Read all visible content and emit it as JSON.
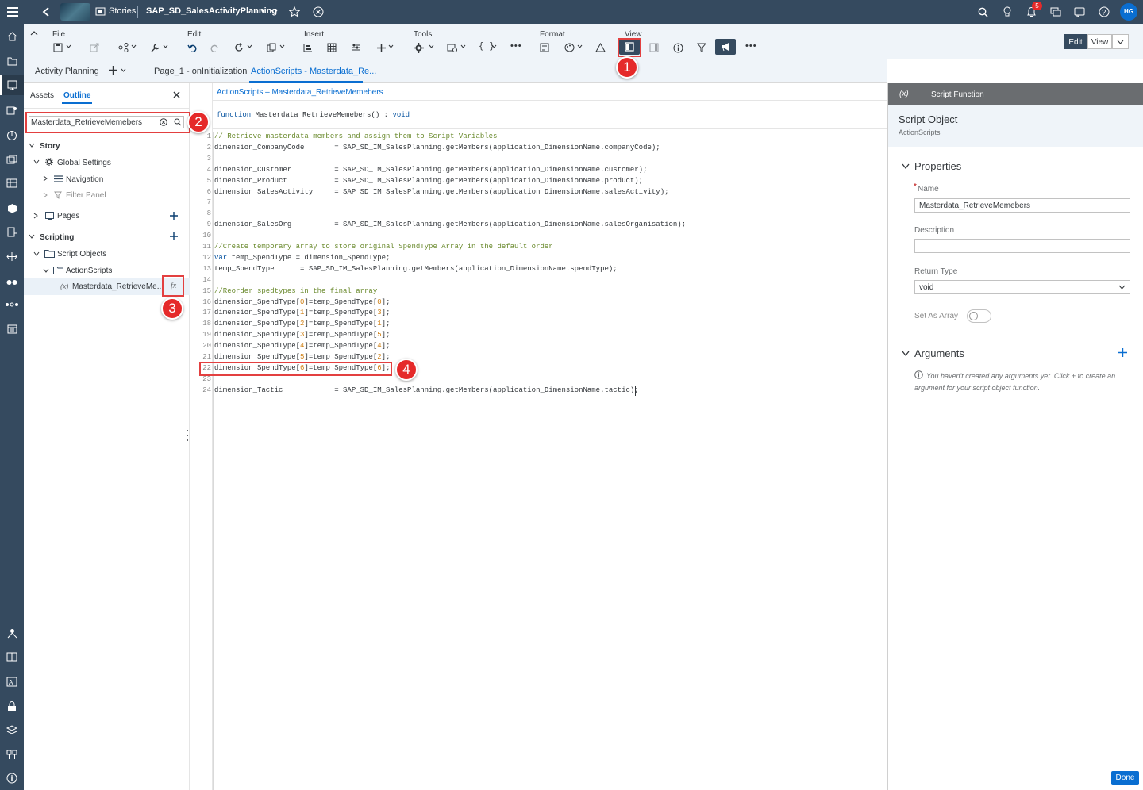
{
  "shell": {
    "app_label": "Stories",
    "story_title": "SAP_SD_SalesActivityPlanning",
    "notification_count": "5",
    "user_initials": "HG"
  },
  "toolbar": {
    "file": "File",
    "edit": "Edit",
    "insert": "Insert",
    "tools": "Tools",
    "format": "Format",
    "view": "View",
    "edit_btn": "Edit",
    "view_btn": "View"
  },
  "tabs": {
    "page_tab": "Activity Planning",
    "page1": "Page_1 - onInitialization",
    "actionscripts": "ActionScripts - Masterdata_Re..."
  },
  "left_panel": {
    "tab_assets": "Assets",
    "tab_outline": "Outline",
    "search_value": "Masterdata_RetrieveMemebers",
    "story": "Story",
    "global_settings": "Global Settings",
    "navigation": "Navigation",
    "filter_panel": "Filter Panel",
    "pages": "Pages",
    "scripting": "Scripting",
    "script_objects": "Script Objects",
    "actionscripts": "ActionScripts",
    "function_prefix": "(x)",
    "function_name": "Masterdata_RetrieveMe...",
    "fx_label": "fx"
  },
  "editor": {
    "breadcrumb": "ActionScripts – Masterdata_RetrieveMemebers",
    "signature_kw": "function",
    "signature_name": "Masterdata_RetrieveMemebers() :",
    "signature_type": "void",
    "lines": [
      {
        "n": "1",
        "t": "// Retrieve masterdata members and assign them to Script Variables"
      },
      {
        "n": "2",
        "t": "dimension_CompanyCode       = SAP_SD_IM_SalesPlanning.getMembers(application_DimensionName.companyCode);"
      },
      {
        "n": "3",
        "t": ""
      },
      {
        "n": "4",
        "t": "dimension_Customer          = SAP_SD_IM_SalesPlanning.getMembers(application_DimensionName.customer);"
      },
      {
        "n": "5",
        "t": "dimension_Product           = SAP_SD_IM_SalesPlanning.getMembers(application_DimensionName.product);"
      },
      {
        "n": "6",
        "t": "dimension_SalesActivity     = SAP_SD_IM_SalesPlanning.getMembers(application_DimensionName.salesActivity);"
      },
      {
        "n": "7",
        "t": ""
      },
      {
        "n": "8",
        "t": ""
      },
      {
        "n": "9",
        "t": "dimension_SalesOrg          = SAP_SD_IM_SalesPlanning.getMembers(application_DimensionName.salesOrganisation);"
      },
      {
        "n": "10",
        "t": ""
      },
      {
        "n": "11",
        "t": "//Create temporary array to store original SpendType Array in the default order"
      },
      {
        "n": "12",
        "t": "var temp_SpendType = dimension_SpendType;"
      },
      {
        "n": "13",
        "t": "temp_SpendType      = SAP_SD_IM_SalesPlanning.getMembers(application_DimensionName.spendType);"
      },
      {
        "n": "14",
        "t": ""
      },
      {
        "n": "15",
        "t": "//Reorder spedtypes in the final array"
      },
      {
        "n": "16",
        "t": "dimension_SpendType[0]=temp_SpendType[0];"
      },
      {
        "n": "17",
        "t": "dimension_SpendType[1]=temp_SpendType[3];"
      },
      {
        "n": "18",
        "t": "dimension_SpendType[2]=temp_SpendType[1];"
      },
      {
        "n": "19",
        "t": "dimension_SpendType[3]=temp_SpendType[5];"
      },
      {
        "n": "20",
        "t": "dimension_SpendType[4]=temp_SpendType[4];"
      },
      {
        "n": "21",
        "t": "dimension_SpendType[5]=temp_SpendType[2];"
      },
      {
        "n": "22",
        "t": "dimension_SpendType[6]=temp_SpendType[6];"
      },
      {
        "n": "23",
        "t": ""
      },
      {
        "n": "24",
        "t": "dimension_Tactic            = SAP_SD_IM_SalesPlanning.getMembers(application_DimensionName.tactic);"
      }
    ]
  },
  "right_panel": {
    "header_icon": "(x)",
    "header_title": "Script Function",
    "object_type": "Script Object",
    "object_parent": "ActionScripts",
    "properties": "Properties",
    "name_required": "*",
    "name_label": "Name",
    "name_value": "Masterdata_RetrieveMemebers",
    "description_label": "Description",
    "description_value": "",
    "return_type_label": "Return Type",
    "return_type_value": "void",
    "set_as_array": "Set As Array",
    "arguments": "Arguments",
    "arguments_hint": "You haven't created any arguments yet. Click + to create an argument for your script object function.",
    "done": "Done"
  },
  "callouts": {
    "c1": "1",
    "c2": "2",
    "c3": "3",
    "c4": "4"
  },
  "colors": {
    "shell": "#354a5f",
    "accent": "#0a6ed1",
    "callout": "#e52a2a"
  }
}
